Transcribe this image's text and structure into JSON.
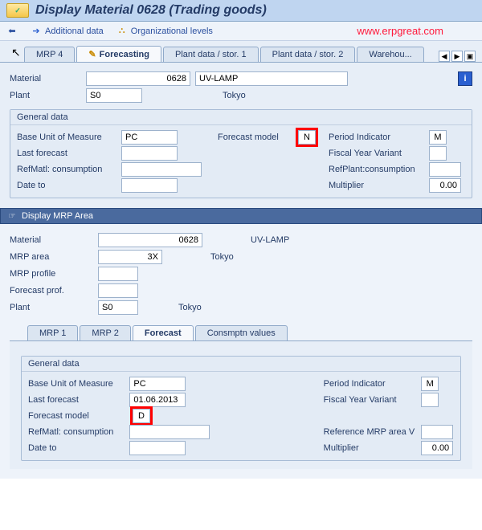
{
  "header": {
    "title": "Display Material                  0628 (Trading goods)"
  },
  "toolbar": {
    "additional_data": "Additional data",
    "org_levels": "Organizational levels"
  },
  "watermark": "www.erpgreat.com",
  "tabs_upper": {
    "mrp4": "MRP 4",
    "forecasting": "Forecasting",
    "plant_stor1": "Plant data / stor. 1",
    "plant_stor2": "Plant data / stor. 2",
    "warehouse": "Warehou..."
  },
  "upper": {
    "material_label": "Material",
    "material_code": "0628",
    "material_desc": "UV-LAMP",
    "plant_label": "Plant",
    "plant_code": "S0",
    "plant_text": "Tokyo"
  },
  "group1": {
    "title": "General data",
    "buom_label": "Base Unit of Measure",
    "buom": "PC",
    "fcmodel_label": "Forecast model",
    "fcmodel": "N",
    "period_label": "Period Indicator",
    "period": "M",
    "lastfc_label": "Last forecast",
    "lastfc": "",
    "fyv_label": "Fiscal Year Variant",
    "fyv": "",
    "refmatl_label": "RefMatl: consumption",
    "refmatl": "",
    "refplant_label": "RefPlant:consumption",
    "refplant": "",
    "dateto_label": "Date to",
    "dateto": "",
    "mult_label": "Multiplier",
    "mult": "0.00"
  },
  "section2": {
    "title": "Display MRP Area",
    "material_label": "Material",
    "material_code": "0628",
    "material_desc": "UV-LAMP",
    "mrparea_label": "MRP area",
    "mrparea_code": "3X",
    "mrparea_text": "Tokyo",
    "mrpprofile_label": "MRP profile",
    "mrpprofile": "",
    "fcprof_label": "Forecast prof.",
    "fcprof": "",
    "plant_label": "Plant",
    "plant_code": "S0",
    "plant_text": "Tokyo"
  },
  "tabs_lower": {
    "mrp1": "MRP 1",
    "mrp2": "MRP 2",
    "forecast": "Forecast",
    "consmptn": "Consmptn values"
  },
  "group2": {
    "title": "General data",
    "buom_label": "Base Unit of Measure",
    "buom": "PC",
    "period_label": "Period Indicator",
    "period": "M",
    "lastfc_label": "Last forecast",
    "lastfc": "01.06.2013",
    "fyv_label": "Fiscal Year Variant",
    "fyv": "",
    "fcmodel_label": "Forecast model",
    "fcmodel": "D",
    "refmatl_label": "RefMatl: consumption",
    "refmatl": "",
    "refarea_label": "Reference MRP area V",
    "refarea": "",
    "dateto_label": "Date to",
    "dateto": "",
    "mult_label": "Multiplier",
    "mult": "0.00"
  }
}
